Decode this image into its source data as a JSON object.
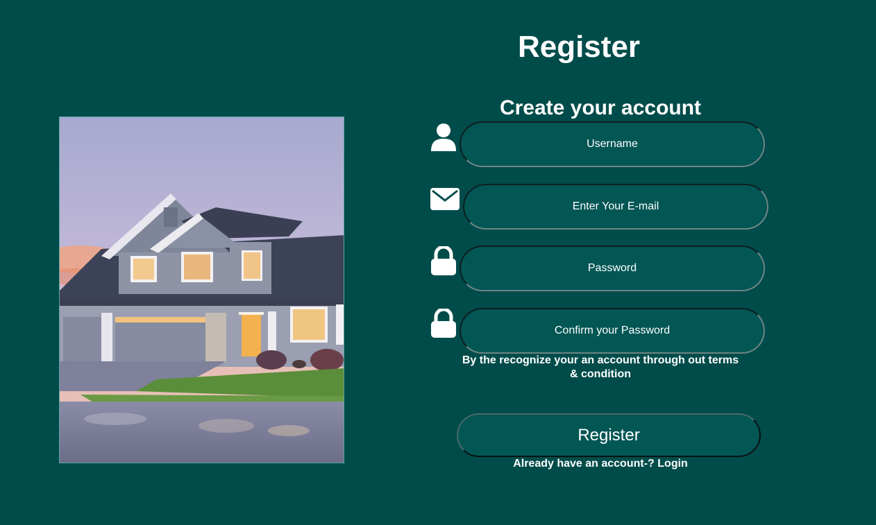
{
  "page": {
    "title": "Register",
    "subtitle": "Create your account"
  },
  "hero_image": {
    "alt": "Two-story house at dusk with wet driveway and lawn"
  },
  "form": {
    "username_placeholder": "Username",
    "email_placeholder": "Enter Your E-mail",
    "password_placeholder": "Password",
    "confirm_placeholder": "Confirm your Password",
    "terms_text": "By the recognize your an account through out terms & condition",
    "submit_label": "Register",
    "login_prompt": "Already have an account-?",
    "login_link": "Login"
  },
  "icons": {
    "username": "user-icon",
    "email": "envelope-icon",
    "password": "lock-icon",
    "confirm": "lock-icon"
  },
  "colors": {
    "background": "#004c4a",
    "field": "#025654",
    "text": "#ffffff"
  }
}
